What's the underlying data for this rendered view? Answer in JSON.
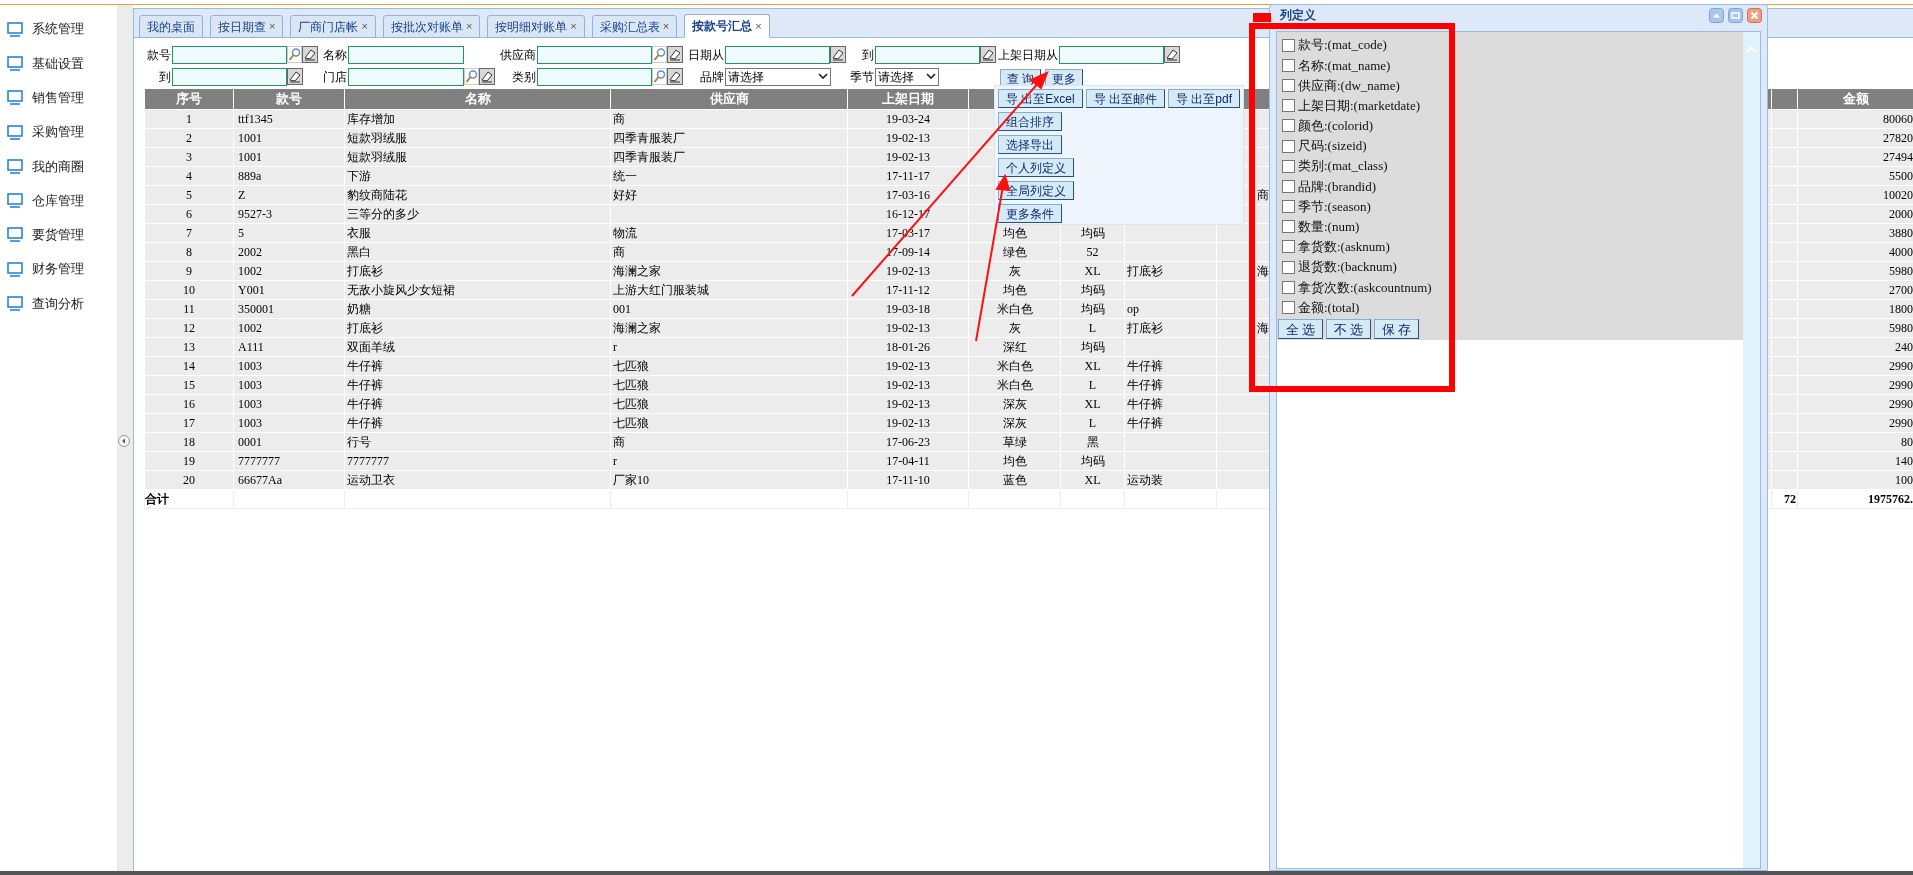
{
  "sidebar": {
    "items": [
      {
        "label": "系统管理"
      },
      {
        "label": "基础设置"
      },
      {
        "label": "销售管理"
      },
      {
        "label": "采购管理"
      },
      {
        "label": "我的商圈"
      },
      {
        "label": "仓库管理"
      },
      {
        "label": "要货管理"
      },
      {
        "label": "财务管理"
      },
      {
        "label": "查询分析"
      }
    ]
  },
  "tabs": [
    {
      "label": "我的桌面",
      "selected": false
    },
    {
      "label": "按日期查",
      "close": "×",
      "selected": false
    },
    {
      "label": "厂商门店帐",
      "close": "×",
      "selected": false
    },
    {
      "label": "按批次对账单",
      "close": "×",
      "selected": false
    },
    {
      "label": "按明细对账单",
      "close": "×",
      "selected": false
    },
    {
      "label": "采购汇总表",
      "close": "×",
      "selected": false
    },
    {
      "label": "按款号汇总",
      "close": "×",
      "selected": true
    }
  ],
  "filters": {
    "rows": [
      [
        {
          "label": "款号",
          "kind": "text",
          "search": true,
          "clear": true
        },
        {
          "label": "名称",
          "kind": "text",
          "search": false,
          "clear": false
        },
        {
          "label": "供应商",
          "kind": "text",
          "search": true,
          "clear": true
        },
        {
          "label": "日期从",
          "kind": "text",
          "search": false,
          "clear": true
        },
        {
          "label": "到",
          "kind": "text",
          "search": false,
          "clear": true
        },
        {
          "label": "上架日期从",
          "kind": "text",
          "search": false,
          "clear": true
        }
      ],
      [
        {
          "label": "到",
          "kind": "text",
          "search": false,
          "clear": true
        },
        {
          "label": "门店",
          "kind": "text",
          "search": true,
          "clear": true
        },
        {
          "label": "类别",
          "kind": "text",
          "search": true,
          "clear": true
        },
        {
          "label": "品牌",
          "kind": "select",
          "value": "请选择"
        },
        {
          "label": "季节",
          "kind": "select",
          "value": "请选择"
        }
      ]
    ],
    "buttons": [
      "查 询",
      "更多"
    ]
  },
  "more_menu": {
    "rows": [
      [
        "导 出至Excel",
        "导 出至邮件",
        "导 出至pdf"
      ],
      [
        "组合排序"
      ],
      [
        "选择导出"
      ],
      [
        "个人列定义"
      ],
      [
        "全局列定义"
      ],
      [
        "更多条件"
      ]
    ]
  },
  "table": {
    "columns": [
      "序号",
      "款号",
      "名称",
      "供应商",
      "上架日期"
    ],
    "amount_column": "金额",
    "rows": [
      [
        "1",
        "ttf1345",
        "库存增加",
        "商",
        "19-03-24",
        null,
        null,
        null,
        null,
        "80060"
      ],
      [
        "2",
        "1001",
        "短款羽绒服",
        "四季青服装厂",
        "19-02-13",
        null,
        null,
        null,
        null,
        "27820"
      ],
      [
        "3",
        "1001",
        "短款羽绒服",
        "四季青服装厂",
        "19-02-13",
        null,
        null,
        null,
        null,
        "27494"
      ],
      [
        "4",
        "889a",
        "下游",
        "统一",
        "17-11-17",
        null,
        null,
        null,
        null,
        "5500"
      ],
      [
        "5",
        "Z",
        "豹纹商陆花",
        "好好",
        "17-03-16",
        null,
        null,
        null,
        "商",
        "10020"
      ],
      [
        "6",
        "9527-3",
        "三等分的多少",
        null,
        "16-12-17",
        null,
        null,
        null,
        null,
        "2000"
      ],
      [
        "7",
        "5",
        "衣服",
        "物流",
        "17-03-17",
        "均色",
        "均码",
        null,
        null,
        "3880"
      ],
      [
        "8",
        "2002",
        "黑白",
        "商",
        "17-09-14",
        "绿色",
        "52",
        null,
        null,
        "4000"
      ],
      [
        "9",
        "1002",
        "打底衫",
        "海澜之家",
        "19-02-13",
        "灰",
        "XL",
        "打底衫",
        "海",
        "5980"
      ],
      [
        "10",
        "Y001",
        "无敌小旋风少女短裙",
        "上游大红门服装城",
        "17-11-12",
        "均色",
        "均码",
        null,
        null,
        "2700"
      ],
      [
        "11",
        "350001",
        "奶糖",
        "001",
        "19-03-18",
        "米白色",
        "均码",
        "op",
        null,
        "1800"
      ],
      [
        "12",
        "1002",
        "打底衫",
        "海澜之家",
        "19-02-13",
        "灰",
        "L",
        "打底衫",
        "海",
        "5980"
      ],
      [
        "13",
        "A111",
        "双面羊绒",
        "r",
        "18-01-26",
        "深红",
        "均码",
        null,
        null,
        "240"
      ],
      [
        "14",
        "1003",
        "牛仔裤",
        "七匹狼",
        "19-02-13",
        "米白色",
        "XL",
        "牛仔裤",
        null,
        "2990"
      ],
      [
        "15",
        "1003",
        "牛仔裤",
        "七匹狼",
        "19-02-13",
        "米白色",
        "L",
        "牛仔裤",
        null,
        "2990"
      ],
      [
        "16",
        "1003",
        "牛仔裤",
        "七匹狼",
        "19-02-13",
        "深灰",
        "XL",
        "牛仔裤",
        null,
        "2990"
      ],
      [
        "17",
        "1003",
        "牛仔裤",
        "七匹狼",
        "19-02-13",
        "深灰",
        "L",
        "牛仔裤",
        null,
        "2990"
      ],
      [
        "18",
        "0001",
        "行号",
        "商",
        "17-06-23",
        "草绿",
        "黑",
        null,
        null,
        "80"
      ],
      [
        "19",
        "7777777",
        "7777777",
        "r",
        "17-04-11",
        "均色",
        "均码",
        null,
        null,
        "140"
      ],
      [
        "20",
        "66677Aa",
        "运动卫衣",
        "厂家10",
        "17-11-10",
        "蓝色",
        "XL",
        "运动装",
        null,
        "100"
      ]
    ],
    "total": {
      "label": "合计",
      "column_10": "72",
      "amount": "1975762."
    }
  },
  "dialog": {
    "title": "列定义",
    "fields": [
      {
        "label": "款号:(mat_code)",
        "checked": false
      },
      {
        "label": "名称:(mat_name)",
        "checked": false
      },
      {
        "label": "供应商:(dw_name)",
        "checked": false
      },
      {
        "label": "上架日期:(marketdate)",
        "checked": false
      },
      {
        "label": "颜色:(colorid)",
        "checked": false
      },
      {
        "label": "尺码:(sizeid)",
        "checked": false
      },
      {
        "label": "类别:(mat_class)",
        "checked": false
      },
      {
        "label": "品牌:(brandid)",
        "checked": false
      },
      {
        "label": "季节:(season)",
        "checked": false
      },
      {
        "label": "数量:(num)",
        "checked": false
      },
      {
        "label": "拿货数:(asknum)",
        "checked": false
      },
      {
        "label": "退货数:(backnum)",
        "checked": false
      },
      {
        "label": "拿货次数:(askcountnum)",
        "checked": false
      },
      {
        "label": "金额:(total)",
        "checked": false
      }
    ],
    "buttons": [
      "全 选",
      "不 选",
      "保 存"
    ]
  }
}
